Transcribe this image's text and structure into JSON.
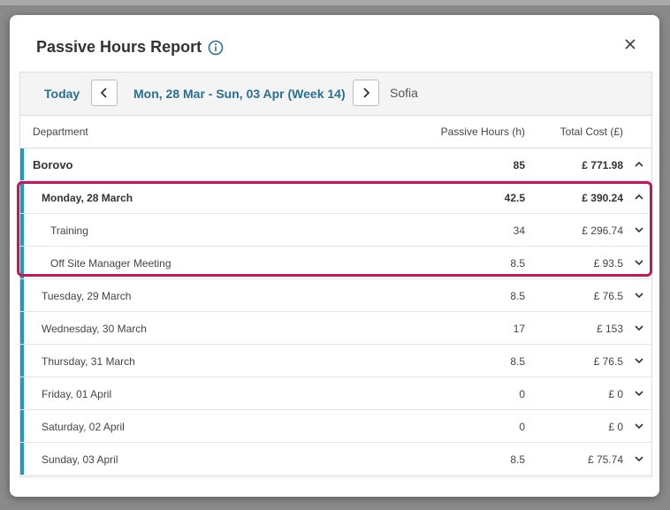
{
  "modal": {
    "title": "Passive Hours Report"
  },
  "toolbar": {
    "today_label": "Today",
    "date_range": "Mon, 28 Mar - Sun, 03 Apr (Week 14)",
    "location": "Sofia"
  },
  "table": {
    "headers": {
      "department": "Department",
      "hours": "Passive Hours (h)",
      "cost": "Total Cost (£)"
    },
    "department": {
      "name": "Borovo",
      "hours": "85",
      "cost": "£ 771.98"
    },
    "rows": [
      {
        "label": "Monday, 28 March",
        "hours": "42.5",
        "cost": "£ 390.24"
      },
      {
        "label": "Training",
        "hours": "34",
        "cost": "£ 296.74"
      },
      {
        "label": "Off Site Manager Meeting",
        "hours": "8.5",
        "cost": "£ 93.5"
      },
      {
        "label": "Tuesday, 29 March",
        "hours": "8.5",
        "cost": "£ 76.5"
      },
      {
        "label": "Wednesday, 30 March",
        "hours": "17",
        "cost": "£ 153"
      },
      {
        "label": "Thursday, 31 March",
        "hours": "8.5",
        "cost": "£ 76.5"
      },
      {
        "label": "Friday, 01 April",
        "hours": "0",
        "cost": "£ 0"
      },
      {
        "label": "Saturday, 02 April",
        "hours": "0",
        "cost": "£ 0"
      },
      {
        "label": "Sunday, 03 April",
        "hours": "8.5",
        "cost": "£ 75.74"
      }
    ]
  },
  "colors": {
    "accent": "#1a9bc7",
    "link": "#2a6f8f",
    "highlight": "#c2185b"
  },
  "icons": [
    "info-icon",
    "close-icon",
    "chevron-left-icon",
    "chevron-right-icon",
    "chevron-up-icon",
    "chevron-down-icon"
  ]
}
